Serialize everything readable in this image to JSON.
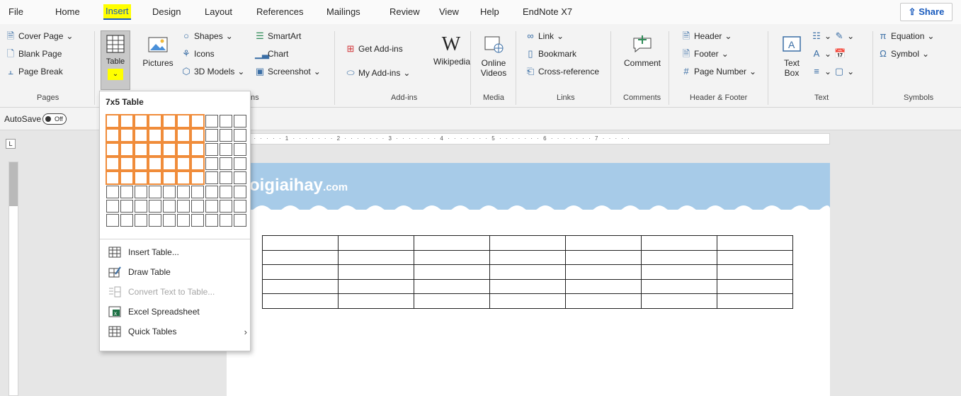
{
  "menu": {
    "items": [
      "File",
      "Home",
      "Insert",
      "Design",
      "Layout",
      "References",
      "Mailings",
      "Review",
      "View",
      "Help",
      "EndNote X7"
    ],
    "active": "Insert",
    "share_label": "Share"
  },
  "ribbon": {
    "pages": {
      "items": [
        "Cover Page",
        "Blank Page",
        "Page Break"
      ],
      "label": "Pages"
    },
    "tables": {
      "table_label": "Table"
    },
    "illustrations": {
      "pictures_label": "Pictures",
      "shapes_label": "Shapes",
      "icons_label": "Icons",
      "models_label": "3D Models",
      "smartart_label": "SmartArt",
      "chart_label": "Chart",
      "screenshot_label": "Screenshot",
      "label_fragment": "ns"
    },
    "addins": {
      "get_label": "Get Add-ins",
      "my_label": "My Add-ins",
      "wikipedia_label": "Wikipedia",
      "label": "Add-ins"
    },
    "media": {
      "online_videos_label_1": "Online",
      "online_videos_label_2": "Videos",
      "label": "Media"
    },
    "links": {
      "link_label": "Link",
      "bookmark_label": "Bookmark",
      "crossref_label": "Cross-reference",
      "label": "Links"
    },
    "comments": {
      "comment_label": "Comment",
      "label": "Comments"
    },
    "header_footer": {
      "header_label": "Header",
      "footer_label": "Footer",
      "page_number_label": "Page Number",
      "label": "Header & Footer"
    },
    "text": {
      "textbox_label_1": "Text",
      "textbox_label_2": "Box",
      "label": "Text"
    },
    "symbols": {
      "equation_label": "Equation",
      "symbol_label": "Symbol",
      "label": "Symbols"
    }
  },
  "autosave": {
    "label": "AutoSave",
    "state": "Off"
  },
  "ruler": {
    "text": "· 1 · · · · · · · 1 · · · · · · · 2 · · · · · · · 3 · · · · · · · 4 · · · · · · · 5 · · · · · · · 6 · · · · · · · 7 · · · · ·"
  },
  "document": {
    "banner_logo": "oigiaihay",
    "banner_logo_suffix": ".com",
    "table": {
      "rows": 5,
      "cols": 7
    }
  },
  "table_dropdown": {
    "title": "7x5 Table",
    "grid": {
      "cols": 10,
      "rows": 8,
      "selected_cols": 7,
      "selected_rows": 5
    },
    "items": [
      {
        "label": "Insert Table...",
        "icon": "table-grid-icon",
        "enabled": true
      },
      {
        "label": "Draw Table",
        "icon": "draw-table-icon",
        "enabled": true
      },
      {
        "label": "Convert Text to Table...",
        "icon": "convert-text-icon",
        "enabled": false
      },
      {
        "label": "Excel Spreadsheet",
        "icon": "excel-icon",
        "enabled": true
      },
      {
        "label": "Quick Tables",
        "icon": "quick-tables-icon",
        "enabled": true,
        "submenu": true
      }
    ]
  },
  "colors": {
    "accent": "#185abd",
    "highlight": "#ffff00",
    "grid_selected": "#f08c3a",
    "banner": "#a7cbe8"
  }
}
